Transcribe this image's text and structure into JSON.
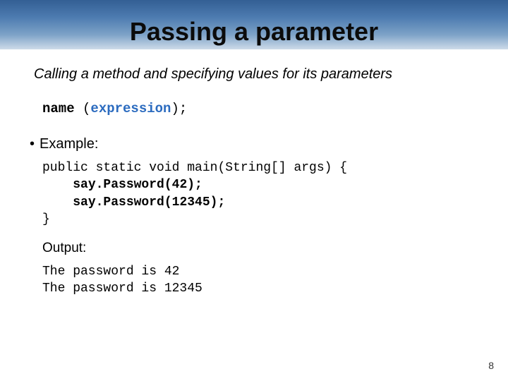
{
  "title": "Passing a parameter",
  "subtitle": "Calling a method and specifying values for its parameters",
  "syntax": {
    "name": "name",
    "open": " (",
    "expr": "expression",
    "close": ");"
  },
  "bullet": {
    "dot": "•",
    "label": "Example:"
  },
  "code": {
    "line1": "public static void main(String[] args) {",
    "line2_indent": "    ",
    "line2": "say.Password(42);",
    "line3_indent": "    ",
    "line3": "say.Password(12345);",
    "line4": "}"
  },
  "output_label": "Output:",
  "output": {
    "line1": "The password is 42",
    "line2": "The password is 12345"
  },
  "page_number": "8"
}
